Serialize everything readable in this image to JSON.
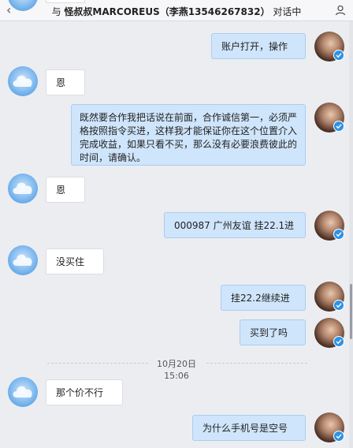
{
  "header": {
    "prefix": "与",
    "contact_name": "怪叔叔MARCOREUS（李燕13546267832）",
    "suffix": "对话中",
    "back_icon": "back-arrow-icon",
    "user_icon": "user-icon"
  },
  "colors": {
    "outgoing_bubble": "#cfe5fb",
    "incoming_bubble": "#ffffff",
    "background": "#ecedf1",
    "verified_badge": "#2d93e6"
  },
  "messages": [
    {
      "side": "out",
      "text": "账户打开，操作"
    },
    {
      "side": "in",
      "text": "恩"
    },
    {
      "side": "out",
      "text": "既然要合作我把话说在前面，合作诚信第一，必须严格按照指令买进，这样我才能保证你在这个位置介入完成收益，如果只看不买，那么没有必要浪费彼此的时间，请确认。"
    },
    {
      "side": "in",
      "text": "恩"
    },
    {
      "side": "out",
      "text": "000987 广州友谊 挂22.1进"
    },
    {
      "side": "in",
      "text": "没买住"
    },
    {
      "side": "out",
      "text": "挂22.2继续进"
    },
    {
      "side": "out",
      "text": "买到了吗"
    },
    {
      "side": "in",
      "text": "那个价不行"
    },
    {
      "side": "out",
      "text": "为什么手机号是空号"
    }
  ],
  "timestamp": {
    "date": "10月20日",
    "time": "15:06"
  }
}
